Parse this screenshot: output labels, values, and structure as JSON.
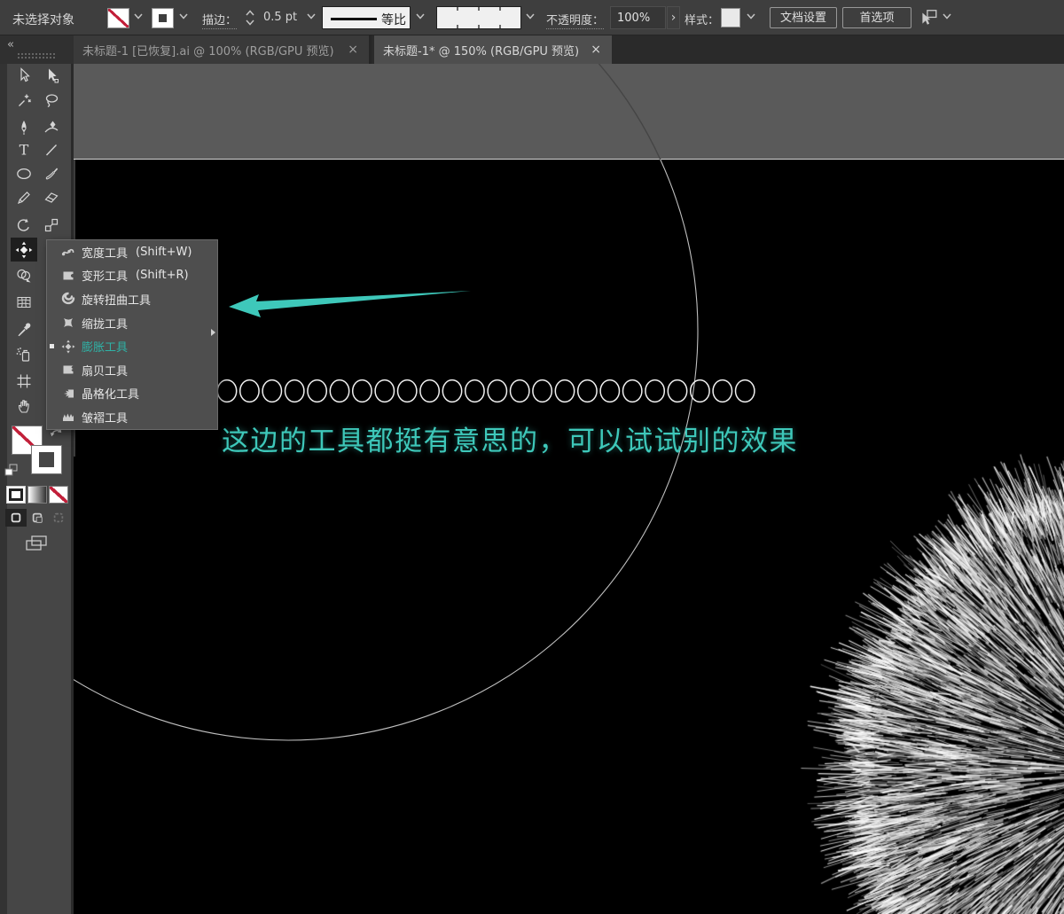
{
  "control_bar": {
    "status": "未选择对象",
    "stroke_label": "描边：",
    "stroke_value": "0.5 pt",
    "profile_value": "等比",
    "opacity_label": "不透明度：",
    "opacity_value": "100%",
    "opacity_more": "›",
    "style_label": "样式：",
    "doc_setup": "文档设置",
    "preferences": "首选项"
  },
  "tabs": [
    {
      "title": "未标题-1 [已恢复].ai @ 100% (RGB/GPU 预览)",
      "close": "×",
      "active": false
    },
    {
      "title": "未标题-1* @ 150% (RGB/GPU 预览)",
      "close": "×",
      "active": true
    }
  ],
  "toolbar": {
    "collapse": "«",
    "tools": [
      "selection",
      "direct-selection",
      "magic-wand",
      "lasso",
      "pen",
      "curvature",
      "type",
      "line-segment",
      "ellipse",
      "paintbrush",
      "pencil",
      "eraser",
      "rotate",
      "scale",
      "bloat-selected",
      "shape-builder",
      "mesh",
      "eyedropper",
      "symbol-sprayer",
      "artboard",
      "hand"
    ]
  },
  "flyout": {
    "items": [
      {
        "label": "宽度工具",
        "shortcut": "(Shift+W)",
        "icon": "width-tool-icon"
      },
      {
        "label": "变形工具",
        "shortcut": "(Shift+R)",
        "icon": "warp-tool-icon"
      },
      {
        "label": "旋转扭曲工具",
        "shortcut": "",
        "icon": "twirl-tool-icon"
      },
      {
        "label": "缩拢工具",
        "shortcut": "",
        "icon": "pucker-tool-icon"
      },
      {
        "label": "膨胀工具",
        "shortcut": "",
        "icon": "bloat-tool-icon",
        "selected": true
      },
      {
        "label": "扇贝工具",
        "shortcut": "",
        "icon": "scallop-tool-icon"
      },
      {
        "label": "晶格化工具",
        "shortcut": "",
        "icon": "crystallize-tool-icon"
      },
      {
        "label": "皱褶工具",
        "shortcut": "",
        "icon": "wrinkle-tool-icon"
      }
    ]
  },
  "canvas": {
    "annotation": "这边的工具都挺有意思的，可以试试别的效果",
    "accent": "#3EC8BA",
    "circle_row": {
      "count": 24,
      "color": "#f0f0f0"
    },
    "guide_circle_color": "#bfbfbf",
    "fluff_color": "#ffffff"
  }
}
